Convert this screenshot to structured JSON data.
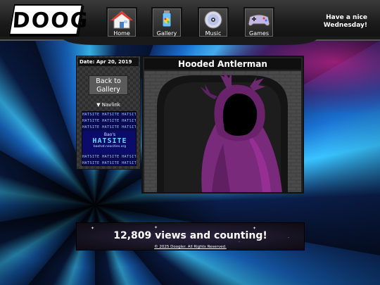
{
  "header": {
    "logo_text": "DOOG",
    "nav": [
      {
        "label": "Home",
        "icon": "house-icon"
      },
      {
        "label": "Gallery",
        "icon": "paint-tube-icon"
      },
      {
        "label": "Music",
        "icon": "cd-icon"
      },
      {
        "label": "Games",
        "icon": "gamepad-icon"
      }
    ],
    "greeting_line1": "Have a nice",
    "greeting_line2": "Wednesday!"
  },
  "sidebar": {
    "date": "Date: Apr 20, 2019",
    "back_button": "Back to Gallery",
    "navlink_label": "▼ Navlink",
    "banner": {
      "owner": "Bao's",
      "title": "HATSITE",
      "url": "baohat.neocities.org",
      "row_text": "HATSITE HATSITE HATSITE HATSITE"
    }
  },
  "artwork": {
    "title": "Hooded Antlerman"
  },
  "footer": {
    "views": "12,809 views and counting!",
    "copyright": "© 2025 Doogler. All Rights Reserved."
  },
  "colors": {
    "accent_blue": "#39c3ff",
    "accent_magenta": "#dc28a0",
    "cloak_purple": "#7a2a7a"
  }
}
